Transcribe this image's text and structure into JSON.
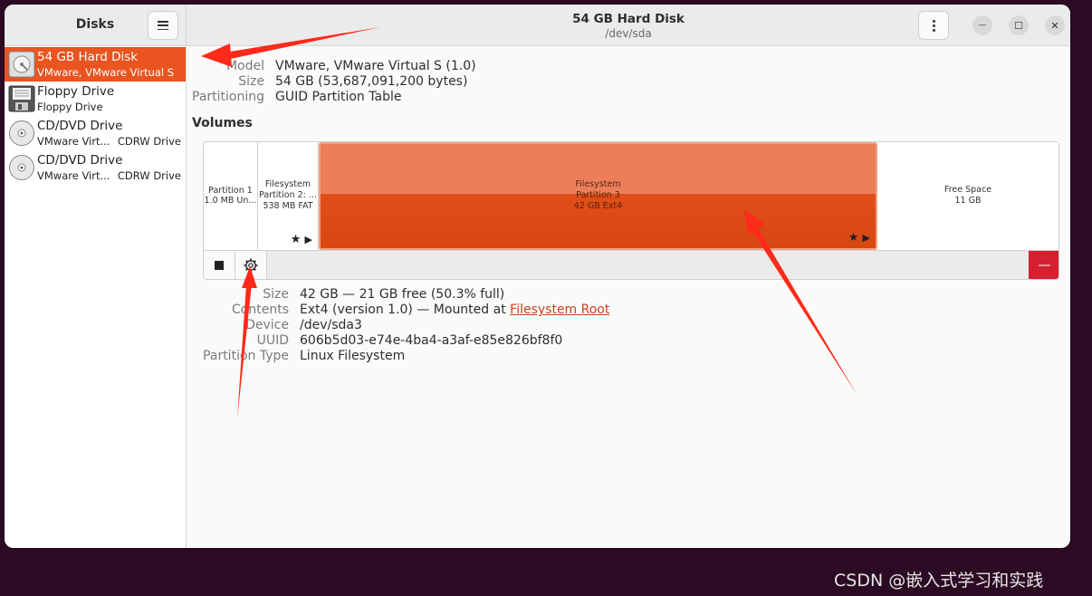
{
  "sidebar": {
    "title": "Disks",
    "drives": [
      {
        "name": "54 GB Hard Disk",
        "sub": "VMware, VMware Virtual S",
        "sub2": ""
      },
      {
        "name": "Floppy Drive",
        "sub": "Floppy Drive",
        "sub2": ""
      },
      {
        "name": "CD/DVD Drive",
        "sub": "VMware Virt...",
        "sub2": "CDRW Drive"
      },
      {
        "name": "CD/DVD Drive",
        "sub": "VMware Virt...",
        "sub2": "CDRW Drive"
      }
    ]
  },
  "header": {
    "title": "54 GB Hard Disk",
    "subtitle": "/dev/sda"
  },
  "disk_info": {
    "model_label": "Model",
    "model_value": "VMware, VMware Virtual S (1.0)",
    "size_label": "Size",
    "size_value": "54 GB (53,687,091,200 bytes)",
    "partitioning_label": "Partitioning",
    "partitioning_value": "GUID Partition Table"
  },
  "volumes": {
    "title": "Volumes",
    "segments": [
      {
        "line1": "Partition 1",
        "line2": "1.0 MB Un...",
        "line3": ""
      },
      {
        "line1": "Filesystem",
        "line2": "Partition 2: ...",
        "line3": "538 MB FAT"
      },
      {
        "line1": "Filesystem",
        "line2": "Partition 3",
        "line3": "42 GB Ext4"
      },
      {
        "line1": "Free Space",
        "line2": "11 GB",
        "line3": ""
      }
    ],
    "star_glyph": "★",
    "play_glyph": "▶",
    "delete_glyph": "—"
  },
  "partition_info": {
    "size_label": "Size",
    "size_value": "42 GB — 21 GB free (50.3% full)",
    "contents_label": "Contents",
    "contents_value": "Ext4 (version 1.0) — Mounted at ",
    "contents_link": "Filesystem Root",
    "device_label": "Device",
    "device_value": "/dev/sda3",
    "uuid_label": "UUID",
    "uuid_value": "606b5d03-e74e-4ba4-a3af-e85e826bf8f0",
    "type_label": "Partition Type",
    "type_value": "Linux Filesystem"
  },
  "window_controls": {
    "minimize": "—",
    "maximize": "☐",
    "close": "✕"
  },
  "watermark": "CSDN @嵌入式学习和实践",
  "colors": {
    "accent": "#e95420",
    "delete": "#d4202f",
    "annotation_arrow": "#ff2a1a"
  }
}
